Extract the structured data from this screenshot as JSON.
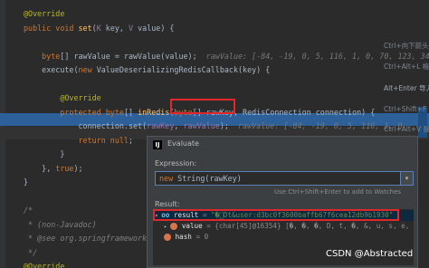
{
  "editor": {
    "lines": [
      {
        "id": "l1",
        "html": [
          {
            "c": "a",
            "t": "@Override"
          }
        ]
      },
      {
        "id": "l2",
        "html": [
          {
            "c": "k",
            "t": "public void "
          },
          {
            "c": "f",
            "t": "set"
          },
          {
            "c": "t",
            "t": "("
          },
          {
            "c": "p",
            "t": "K "
          },
          {
            "c": "t",
            "t": "key, "
          },
          {
            "c": "p",
            "t": "V "
          },
          {
            "c": "t",
            "t": "value) {"
          }
        ]
      },
      {
        "id": "l3",
        "html": []
      },
      {
        "id": "l4",
        "html": [
          {
            "c": "k",
            "t": "    byte"
          },
          {
            "c": "t",
            "t": "[] rawValue = rawValue(value);  "
          },
          {
            "c": "h",
            "t": "rawValue: [-84, -19, 0, 5, 116, 1, 0, 70, 123, 34, 1"
          }
        ]
      },
      {
        "id": "l5",
        "html": [
          {
            "c": "t",
            "t": "    execute("
          },
          {
            "c": "k",
            "t": "new "
          },
          {
            "c": "t",
            "t": "ValueDeserializingRedisCallback(key) {"
          }
        ]
      },
      {
        "id": "l6",
        "html": []
      },
      {
        "id": "l7",
        "html": [
          {
            "c": "a",
            "t": "        @Override"
          }
        ]
      },
      {
        "id": "l8",
        "html": [
          {
            "c": "k",
            "t": "        protected byte"
          },
          {
            "c": "t",
            "t": "[] "
          },
          {
            "c": "f",
            "t": "inRedis"
          },
          {
            "c": "t",
            "t": "("
          },
          {
            "c": "k",
            "t": "byte"
          },
          {
            "c": "t",
            "t": "[] rawKey, RedisConnection connection) {  "
          }
        ]
      },
      {
        "id": "l9",
        "html": [
          {
            "c": "t",
            "t": "            connection.set("
          },
          {
            "c": "p",
            "t": "rawKey"
          },
          {
            "c": "t",
            "t": ", "
          },
          {
            "c": "p",
            "t": "rawValue"
          },
          {
            "c": "t",
            "t": ");  "
          },
          {
            "c": "h",
            "t": "rawValue: [-84, -19, 0, 5, 116, 1, 0"
          }
        ]
      },
      {
        "id": "l10",
        "html": [
          {
            "c": "k",
            "t": "            return null"
          },
          {
            "c": "t",
            "t": ";"
          }
        ]
      },
      {
        "id": "l11",
        "html": [
          {
            "c": "t",
            "t": "        }"
          }
        ]
      },
      {
        "id": "l12",
        "html": [
          {
            "c": "t",
            "t": "    }, "
          },
          {
            "c": "k",
            "t": "true"
          },
          {
            "c": "t",
            "t": ");"
          }
        ]
      },
      {
        "id": "l13",
        "html": [
          {
            "c": "t",
            "t": "}"
          }
        ]
      },
      {
        "id": "l14",
        "html": []
      },
      {
        "id": "l15",
        "html": [
          {
            "c": "c",
            "t": "/*"
          }
        ]
      },
      {
        "id": "l16",
        "html": [
          {
            "c": "c",
            "t": " * (non-Javadoc)"
          }
        ]
      },
      {
        "id": "l17",
        "html": [
          {
            "c": "c",
            "t": " * @see org.springframework"
          }
        ]
      },
      {
        "id": "l18",
        "html": [
          {
            "c": "c",
            "t": " */"
          }
        ]
      },
      {
        "id": "l19",
        "html": [
          {
            "c": "a",
            "t": "@Override"
          }
        ]
      }
    ],
    "side_hints": [
      {
        "text": "Ctrl+向下箭头",
        "bright": false
      },
      {
        "text": "Ctrl+Alt+L 格式",
        "bright": false
      },
      {
        "text": "Alt+Enter 导入",
        "bright": true
      },
      {
        "text": "Ctrl+Shift+F",
        "bright": false
      },
      {
        "text": "Ctrl+Alt+V 提",
        "bright": false
      }
    ]
  },
  "dialog": {
    "logo": "IJ",
    "title": "Evaluate",
    "expression_label": "Expression:",
    "expression_parts": [
      {
        "c": "k",
        "t": "new "
      },
      {
        "c": "t",
        "t": "String(rawKey)"
      }
    ],
    "dropdown_glyph": "▾",
    "hint": "Use Ctrl+Shift+Enter to add to Watches",
    "result_label": "Result:",
    "rows": [
      {
        "caret": "▾",
        "kind": "oo",
        "icon": "oo",
        "name": "result",
        "eq": " = ",
        "value": "\"�\u0000Dt&user:d3bc0f3600baffb67f6cea12db9b1930\"",
        "selected": true
      },
      {
        "caret": "▸",
        "kind": "field",
        "name": "value",
        "eq": " = ",
        "value": "{char[45]@16354} [�, �, �, D, t, �, &, u, s, e, r, :, d, 3, b, c, 0, f, 3, 6, 0,",
        "selected": false
      },
      {
        "caret": "",
        "kind": "field",
        "name": "hash",
        "eq": " = ",
        "value": "0",
        "selected": false
      }
    ]
  },
  "watermark": "CSDN @Abstracted"
}
